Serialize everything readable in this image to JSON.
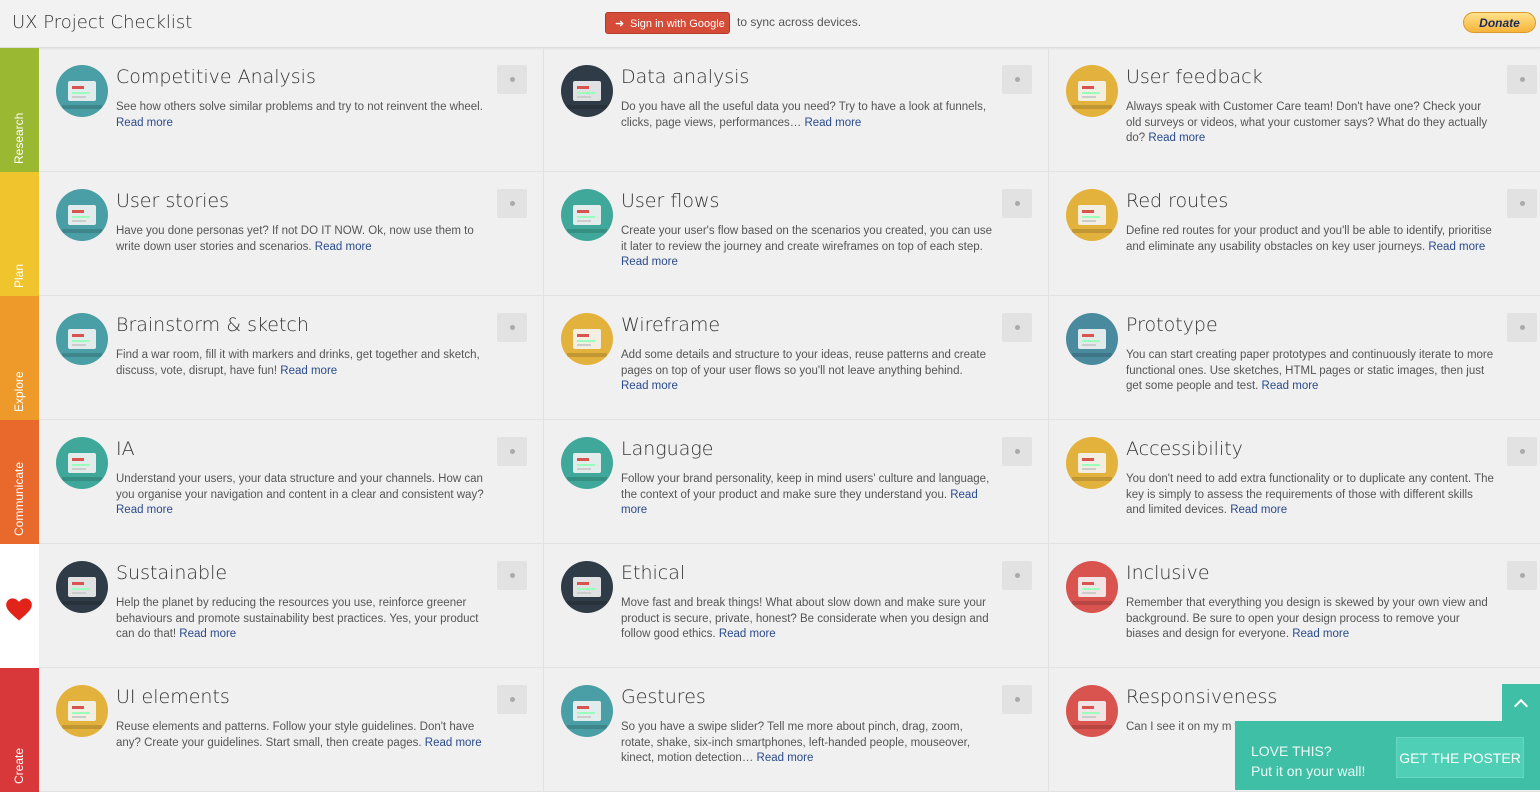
{
  "header": {
    "title": "UX Project Checklist",
    "google_button": "Sign in with Google",
    "sync_text": "to sync across devices.",
    "donate": "Donate"
  },
  "rows": [
    {
      "category": "Research",
      "color": "#9ab832",
      "cards": [
        {
          "title": "Competitive Analysis",
          "desc": "See how others solve similar problems and try to not reinvent the wheel. ",
          "link": "Read more",
          "icon": "magnifier-chart-icon",
          "iconColor": "#4a9ea5"
        },
        {
          "title": "Data analysis",
          "desc": "Do you have all the useful data you need? Try to have a look at funnels, clicks, page views, performances… ",
          "link": "Read more",
          "icon": "monitor-graph-icon",
          "iconColor": "#2f3b46"
        },
        {
          "title": "User feedback",
          "desc": "Always speak with Customer Care team! Don't have one? Check your old surveys or videos, what your customer says? What do they actually do? ",
          "link": "Read more",
          "icon": "arrows-icon",
          "iconColor": "#e3b23c"
        }
      ]
    },
    {
      "category": "Plan",
      "color": "#f0c42c",
      "cards": [
        {
          "title": "User stories",
          "desc": "Have you done personas yet? If not DO IT NOW. Ok, now use them to write down user stories and scenarios. ",
          "link": "Read more",
          "icon": "id-card-icon",
          "iconColor": "#4a9ea5"
        },
        {
          "title": "User flows",
          "desc": "Create your user's flow based on the scenarios you created, you can use it later to review the journey and create wireframes on top of each step. ",
          "link": "Read more",
          "icon": "flow-notes-icon",
          "iconColor": "#3fa89a"
        },
        {
          "title": "Red routes",
          "desc": "Define red routes for your product and you'll be able to identify, prioritise and eliminate any usability obstacles on key user journeys. ",
          "link": "Read more",
          "icon": "browser-window-icon",
          "iconColor": "#e3b23c"
        }
      ]
    },
    {
      "category": "Explore",
      "color": "#ee9a2b",
      "cards": [
        {
          "title": "Brainstorm & sketch",
          "desc": "Find a war room, fill it with markers and drinks, get together and sketch, discuss, vote, disrupt, have fun! ",
          "link": "Read more",
          "icon": "beer-mug-icon",
          "iconColor": "#4a9ea5"
        },
        {
          "title": "Wireframe",
          "desc": "Add some details and structure to your ideas, reuse patterns and create pages on top of your user flows so you'll not leave anything behind. ",
          "link": "Read more",
          "icon": "pencil-paper-icon",
          "iconColor": "#e3b23c"
        },
        {
          "title": "Prototype",
          "desc": "You can start creating paper prototypes and continuously iterate to more functional ones. Use sketches, HTML pages or static images, then just get some people and test. ",
          "link": "Read more",
          "icon": "gears-icon",
          "iconColor": "#4a8a9e"
        }
      ]
    },
    {
      "category": "Communicate",
      "color": "#e9692c",
      "cards": [
        {
          "title": "IA",
          "desc": "Understand your users, your data structure and your channels. How can you organise your navigation and content in a clear and consistent way? ",
          "link": "Read more",
          "icon": "sitemap-icon",
          "iconColor": "#3fa89a"
        },
        {
          "title": "Language",
          "desc": "Follow your brand personality, keep in mind users' culture and language, the context of your product and make sure they understand you. ",
          "link": "Read more",
          "icon": "typewriter-icon",
          "iconColor": "#3fa89a"
        },
        {
          "title": "Accessibility",
          "desc": "You don't need to add extra functionality or to duplicate any content. The key is simply to assess the requirements of those with different skills and limited devices. ",
          "link": "Read more",
          "icon": "wheelchair-icon",
          "iconColor": "#e3b23c"
        }
      ]
    },
    {
      "category": "",
      "color": "#ffffff",
      "cards": [
        {
          "title": "Sustainable",
          "desc": "Help the planet by reducing the resources you use, reinforce greener behaviours and promote sustainability best practices. Yes, your product can do that! ",
          "link": "Read more",
          "icon": "plant-icon",
          "iconColor": "#2f3b46"
        },
        {
          "title": "Ethical",
          "desc": "Move fast and break things! What about slow down and make sure your product is secure, private, honest? Be considerate when you design and follow good ethics. ",
          "link": "Read more",
          "icon": "first-aid-kit-icon",
          "iconColor": "#2f3b46"
        },
        {
          "title": "Inclusive",
          "desc": "Remember that everything you design is skewed by your own view and background. Be sure to open your design process to remove your biases and design for everyone. ",
          "link": "Read more",
          "icon": "handshake-icon",
          "iconColor": "#d9534f"
        }
      ]
    },
    {
      "category": "Create",
      "color": "#d8383a",
      "cards": [
        {
          "title": "UI elements",
          "desc": "Reuse elements and patterns. Follow your style guidelines. Don't have any? Create your guidelines. Start small, then create pages. ",
          "link": "Read more",
          "icon": "form-icon",
          "iconColor": "#e3b23c"
        },
        {
          "title": "Gestures",
          "desc": "So you have a swipe slider? Tell me more about pinch, drag, zoom, rotate, shake, six-inch smartphones, left-handed people, mouseover, kinect, motion detection… ",
          "link": "Read more",
          "icon": "smartphone-icon",
          "iconColor": "#4a9ea5"
        },
        {
          "title": "Responsiveness",
          "desc": "Can I see it on my m which works as a re device experience. R",
          "link": "",
          "icon": "devices-icon",
          "iconColor": "#d9534f"
        }
      ]
    }
  ],
  "poster": {
    "line1": "LOVE THIS?",
    "line2": "Put it on your wall!",
    "button": "GET THE POSTER"
  }
}
